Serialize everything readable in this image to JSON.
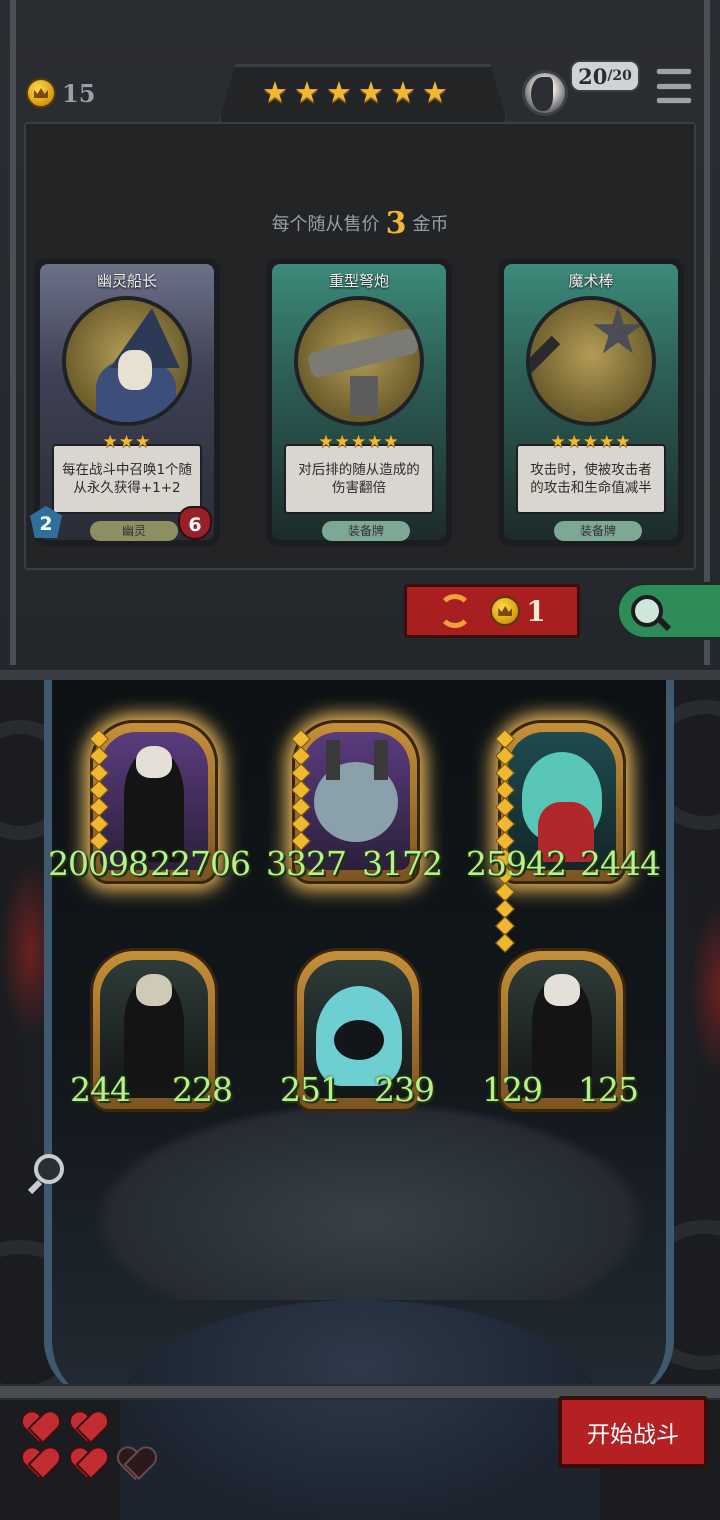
{
  "hud": {
    "gold": "15",
    "shop_stars": "★★★★★★",
    "player_count": "20",
    "player_max": "/20",
    "icons": [
      "coin-icon",
      "avatar",
      "menu-icon"
    ]
  },
  "shop": {
    "sell_prefix": "每个随从售价",
    "sell_price": "3",
    "sell_suffix": "金币",
    "cards": [
      {
        "title": "幽灵船长",
        "stars": "★★★",
        "desc": "每在战斗中召唤1个随从永久获得+1+2",
        "tag": "幽灵",
        "attack": "2",
        "health": "6"
      },
      {
        "title": "重型弩炮",
        "stars": "★★★★★",
        "desc": "对后排的随从造成的伤害翻倍",
        "tag": "装备牌"
      },
      {
        "title": "魔术棒",
        "stars": "★★★★★",
        "desc": "攻击时，使被攻击者的攻击和生命值减半",
        "tag": "装备牌"
      }
    ],
    "refresh_cost": "1"
  },
  "board": {
    "units": [
      {
        "attack": "20098",
        "health": "22706"
      },
      {
        "attack": "3327",
        "health": "3172"
      },
      {
        "attack": "25942",
        "health": "2444"
      },
      {
        "attack": "244",
        "health": "228"
      },
      {
        "attack": "251",
        "health": "239"
      },
      {
        "attack": "129",
        "health": "125"
      }
    ]
  },
  "footer": {
    "lives_full": 4,
    "lives_total": 5,
    "start_label": "开始战斗"
  },
  "colors": {
    "gold": "#f0b731",
    "red_button": "#b52022",
    "green_stat": "#b8f08a",
    "search_green": "#2f8b58"
  }
}
